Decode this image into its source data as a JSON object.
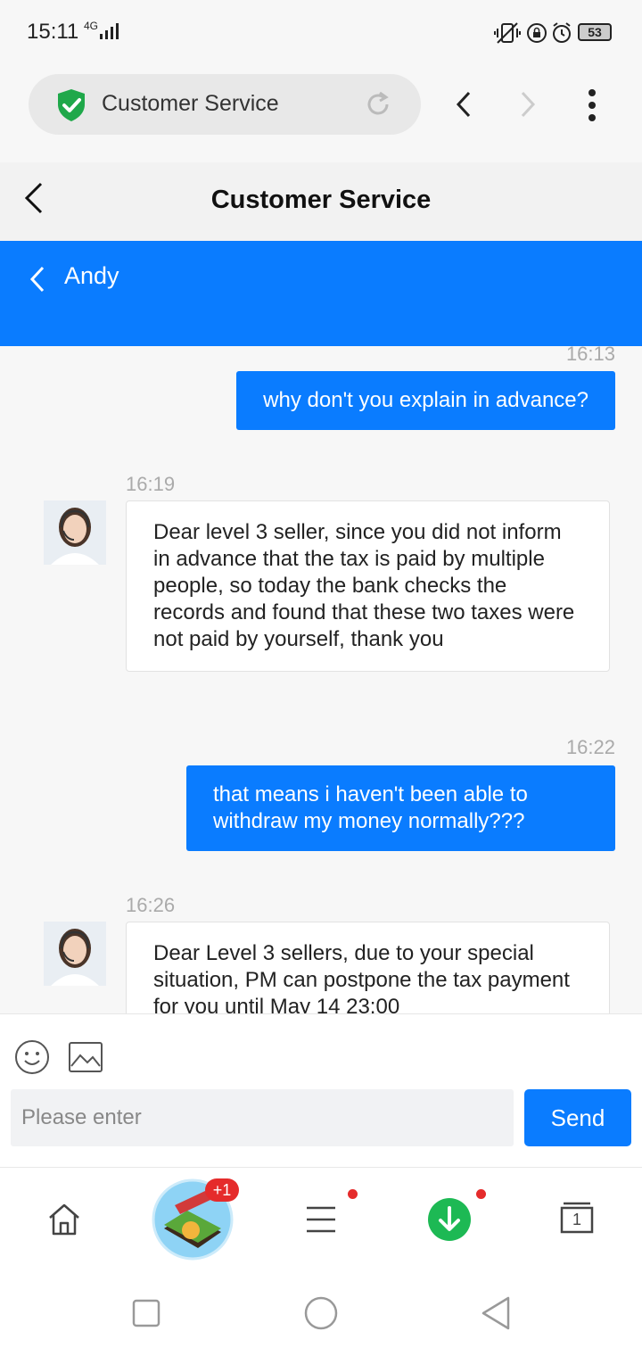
{
  "status_bar": {
    "time": "15:11",
    "network": "4G",
    "battery": "53"
  },
  "browser": {
    "url_title": "Customer Service",
    "icons": [
      "shield-check-icon",
      "reload-icon",
      "back-icon",
      "forward-icon",
      "more-icon"
    ]
  },
  "page": {
    "title": "Customer Service"
  },
  "agent": {
    "name": "Andy"
  },
  "messages": [
    {
      "direction": "out",
      "time": "16:13",
      "text": "why don't you explain in advance?"
    },
    {
      "direction": "in",
      "time": "16:19",
      "text": "Dear level 3 seller, since you did not inform in advance that the tax is paid by multiple people, so today the bank checks the records and found that these two taxes were not paid by yourself, thank you"
    },
    {
      "direction": "out",
      "time": "16:22",
      "text": "that means i haven't been able to withdraw my money normally???"
    },
    {
      "direction": "in",
      "time": "16:26",
      "text": "Dear Level 3 sellers, due to your special situation, PM can postpone the tax payment for you until May 14 23:00"
    }
  ],
  "composer": {
    "placeholder": "Please enter",
    "send_label": "Send"
  },
  "bottom_nav": {
    "game_badge": "+1",
    "tabs_count": "1"
  },
  "colors": {
    "accent": "#0a7cff",
    "badge": "#e52b2b",
    "download": "#1db954"
  }
}
